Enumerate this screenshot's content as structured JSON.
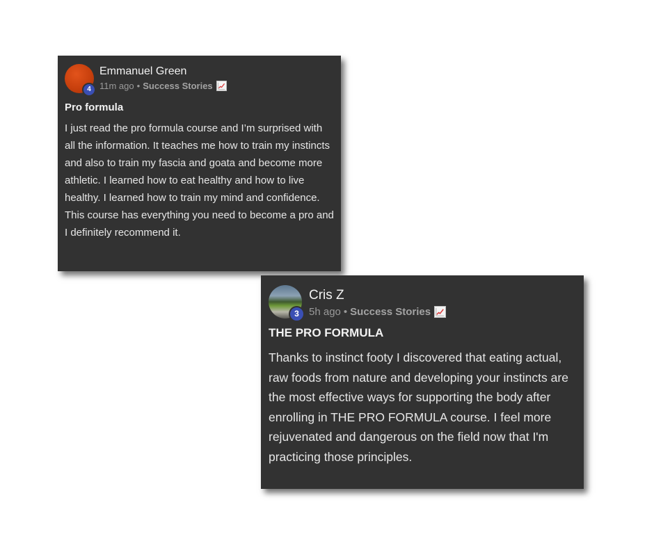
{
  "posts": [
    {
      "author": "Emmanuel Green",
      "level": "4",
      "time": "11m ago",
      "separator": "•",
      "category": "Success Stories",
      "category_icon": "chart-increasing-icon",
      "title": "Pro formula",
      "body": "I just read the pro formula course and I’m surprised with all the information. It teaches me how to train my instincts and also to train my fascia and goata and become more athletic. I learned how to eat healthy and how to live healthy. I learned how to train my mind and confidence. This course has everything you need to become a pro and I definitely recommend it."
    },
    {
      "author": "Cris Z",
      "level": "3",
      "time": "5h ago",
      "separator": "•",
      "category": "Success Stories",
      "category_icon": "chart-increasing-icon",
      "title": "THE PRO FORMULA",
      "body": "Thanks to instinct footy I discovered that eating actual, raw foods from nature and developing your instincts are the most effective ways for supporting the body after enrolling in THE PRO FORMULA course. I feel more rejuvenated and dangerous on the field now that I'm practicing those principles."
    }
  ],
  "colors": {
    "card_background": "#323232",
    "level_badge": "#3a4fb4",
    "chart_line": "#d93a3a"
  }
}
